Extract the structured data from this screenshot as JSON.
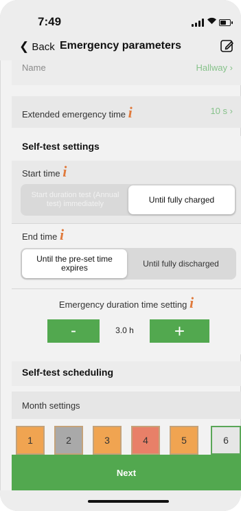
{
  "status_bar": {
    "time": "7:49"
  },
  "nav": {
    "back_label": "Back",
    "title": "Emergency parameters",
    "edit_icon": "edit-icon"
  },
  "name_row": {
    "label": "Name",
    "value": "Hallway"
  },
  "extended_row": {
    "label": "Extended emergency time",
    "value": "10 s"
  },
  "self_test_settings": {
    "header": "Self-test settings"
  },
  "start_time": {
    "label": "Start time",
    "options": [
      "Start duration test (Annual test) immediately",
      "Until fully charged"
    ],
    "selected": 1
  },
  "end_time": {
    "label": "End time",
    "options": [
      "Until the pre-set time expires",
      "Until fully discharged"
    ],
    "selected": 0
  },
  "duration": {
    "label": "Emergency duration time setting",
    "value": "3.0 h",
    "minus": "-",
    "plus": "+"
  },
  "scheduling": {
    "header": "Self-test scheduling",
    "month_label": "Month settings"
  },
  "months": [
    {
      "label": "1",
      "color": "#f0a451"
    },
    {
      "label": "2",
      "color": "#a9a9a9"
    },
    {
      "label": "3",
      "color": "#f0a451"
    },
    {
      "label": "4",
      "color": "#e88068"
    },
    {
      "label": "5",
      "color": "#f0a451"
    },
    {
      "label": "6",
      "color": "#e6e6e6"
    }
  ],
  "footer": {
    "next_label": "Next"
  },
  "colors": {
    "accent_green": "#52a84f",
    "info_orange": "#e07a3c",
    "value_green": "#86c28a"
  }
}
